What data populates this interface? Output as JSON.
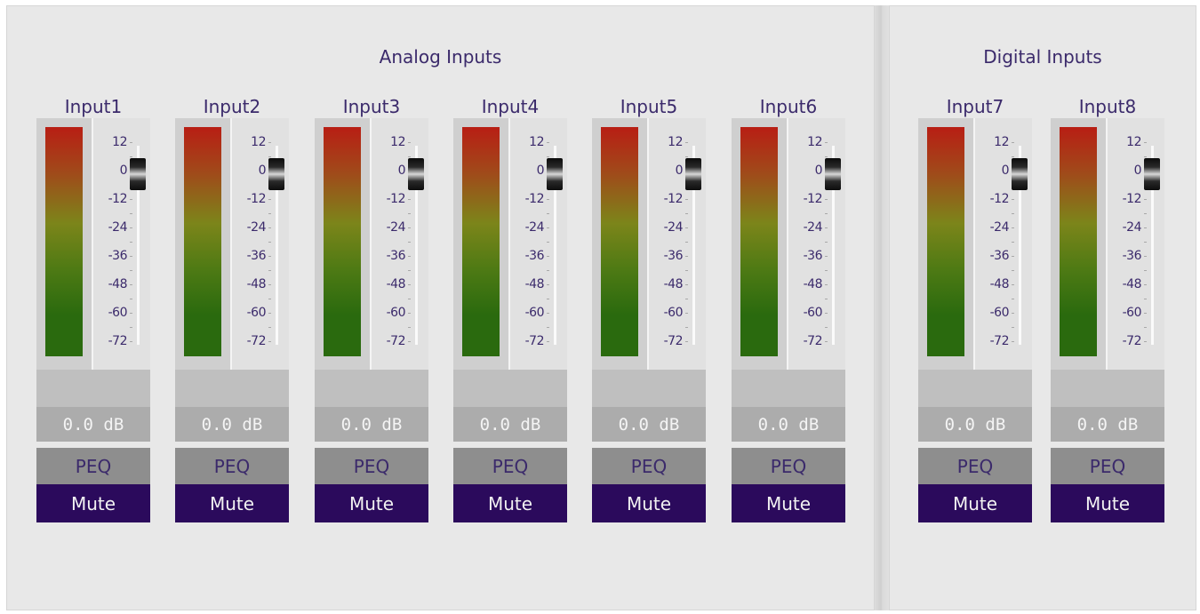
{
  "groups": [
    {
      "title": "Analog Inputs"
    },
    {
      "title": "Digital Inputs"
    }
  ],
  "channels": [
    {
      "name": "Input1",
      "gain": "0.0 dB",
      "peq": "PEQ",
      "mute": "Mute"
    },
    {
      "name": "Input2",
      "gain": "0.0 dB",
      "peq": "PEQ",
      "mute": "Mute"
    },
    {
      "name": "Input3",
      "gain": "0.0 dB",
      "peq": "PEQ",
      "mute": "Mute"
    },
    {
      "name": "Input4",
      "gain": "0.0 dB",
      "peq": "PEQ",
      "mute": "Mute"
    },
    {
      "name": "Input5",
      "gain": "0.0 dB",
      "peq": "PEQ",
      "mute": "Mute"
    },
    {
      "name": "Input6",
      "gain": "0.0 dB",
      "peq": "PEQ",
      "mute": "Mute"
    },
    {
      "name": "Input7",
      "gain": "0.0 dB",
      "peq": "PEQ",
      "mute": "Mute"
    },
    {
      "name": "Input8",
      "gain": "0.0 dB",
      "peq": "PEQ",
      "mute": "Mute"
    }
  ],
  "scale_labels": [
    "12",
    "0",
    "-12",
    "-24",
    "-36",
    "-48",
    "-60",
    "-72"
  ],
  "colors": {
    "accent_text": "#3b2a6b",
    "mute_bg": "#2b0a5c",
    "meter_top": "#b81e14",
    "meter_bottom": "#2a6a0e"
  }
}
